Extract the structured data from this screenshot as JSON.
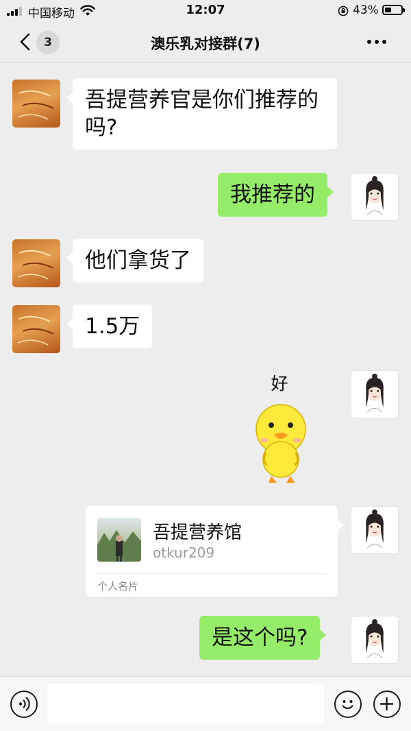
{
  "status_bar": {
    "carrier": "中国移动",
    "time": "12:07",
    "battery_percent": "43%",
    "battery_level": 0.43,
    "icons": [
      "signal-icon",
      "wifi-icon",
      "orientation-lock-icon",
      "battery-icon"
    ]
  },
  "nav": {
    "back_icon": "chevron-left-icon",
    "unread_count": "3",
    "title": "澳乐乳对接群(7)",
    "more_icon": "more-dots-icon"
  },
  "messages": [
    {
      "side": "left",
      "type": "text",
      "text": "吾提营养官是你们推荐的吗?"
    },
    {
      "side": "right",
      "type": "text",
      "text": "我推荐的"
    },
    {
      "side": "left",
      "type": "text",
      "text": "他们拿货了"
    },
    {
      "side": "left",
      "type": "text",
      "text": "1.5万"
    },
    {
      "side": "right",
      "type": "sticker",
      "text": "好",
      "icon": "yellow-duck-sticker"
    },
    {
      "side": "right",
      "type": "contact_card",
      "name": "吾提营养馆",
      "account": "otkur209",
      "card_type": "个人名片"
    },
    {
      "side": "right",
      "type": "text",
      "text": "是这个吗?"
    }
  ],
  "input_bar": {
    "placeholder": "",
    "icons": [
      "voice-icon",
      "emoji-icon",
      "plus-icon"
    ]
  },
  "colors": {
    "background": "#ededed",
    "sent_bubble": "#95ec69",
    "received_bubble": "#ffffff"
  }
}
